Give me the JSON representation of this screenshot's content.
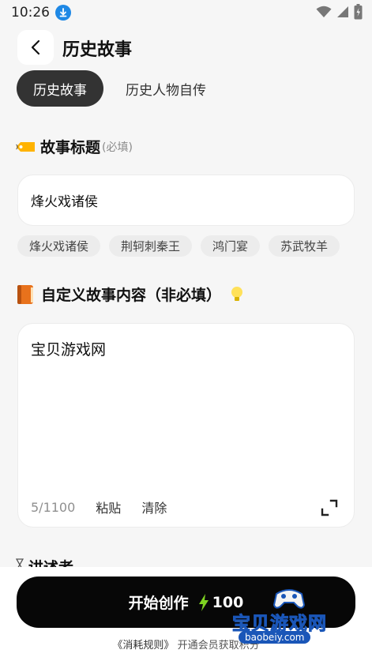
{
  "status_bar": {
    "time": "10:26"
  },
  "header": {
    "title": "历史故事"
  },
  "tabs": [
    {
      "label": "历史故事",
      "active": true
    },
    {
      "label": "历史人物自传",
      "active": false
    }
  ],
  "story_title": {
    "label": "故事标题",
    "hint": "(必填)",
    "value": "烽火戏诸侯",
    "suggestions": [
      "烽火戏诸侯",
      "荆轲刺秦王",
      "鸿门宴",
      "苏武牧羊"
    ]
  },
  "custom_content": {
    "label": "自定义故事内容（非必填）",
    "value": "宝贝游戏网",
    "char_count": "5/1100",
    "paste_label": "粘贴",
    "clear_label": "清除"
  },
  "narrator": {
    "label": "讲述者"
  },
  "create": {
    "label": "开始创作",
    "cost": "100"
  },
  "footer": {
    "rule_link": "《消耗规则》",
    "text": "开通会员获取积分"
  },
  "watermark": {
    "text": "宝贝游戏网",
    "url": "baobeiy.com"
  },
  "colors": {
    "tab_active_bg": "#333333",
    "button_bg": "#070707",
    "bolt": "#7ed321",
    "status_download": "#1e88e5"
  }
}
